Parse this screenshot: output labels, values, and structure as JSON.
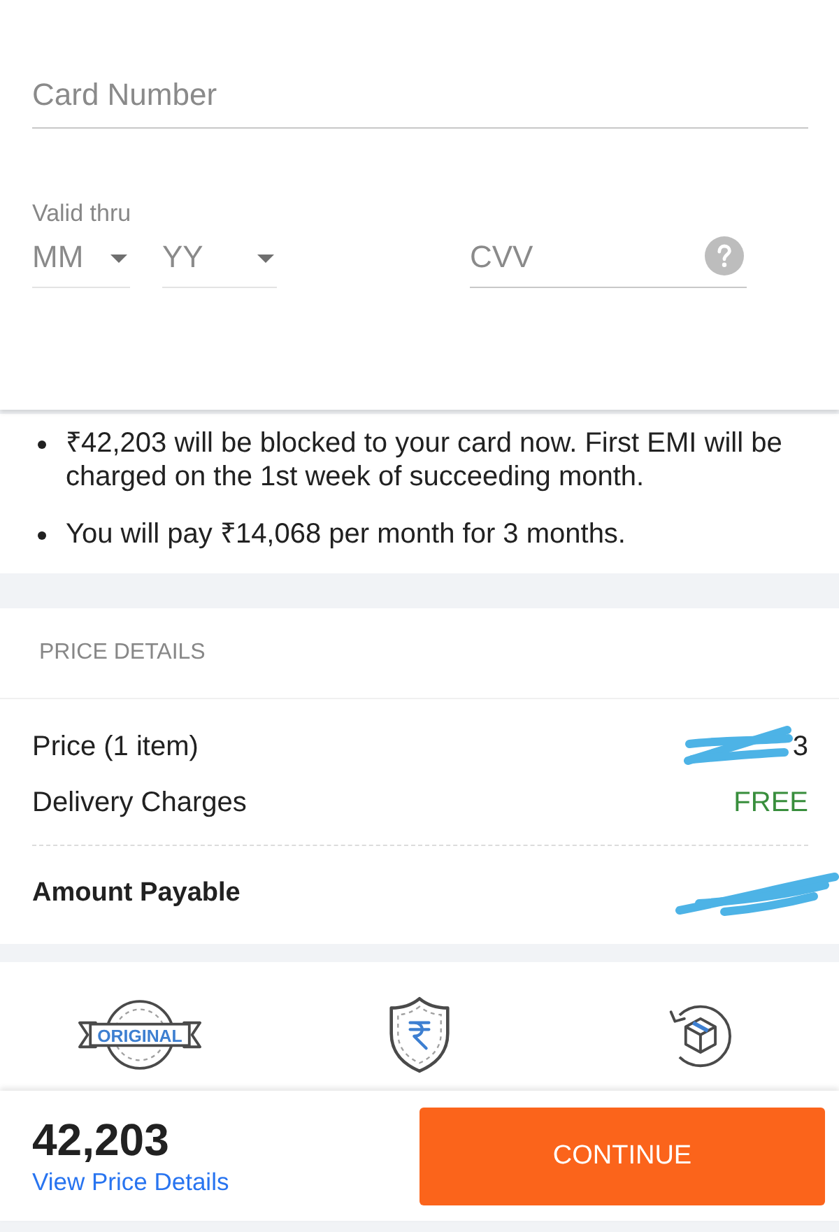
{
  "card_form": {
    "card_number": {
      "placeholder": "Card Number"
    },
    "valid_thru": {
      "label": "Valid thru",
      "month": {
        "placeholder": "MM"
      },
      "year": {
        "placeholder": "YY"
      }
    },
    "cvv": {
      "placeholder": "CVV"
    }
  },
  "emi_notes": [
    "₹42,203 will be blocked to your card now. First EMI will be charged on the 1st week of succeeding month.",
    "You will pay ₹14,068 per month for 3 months."
  ],
  "price_details": {
    "title": "PRICE DETAILS",
    "rows": [
      {
        "label": "Price (1 item)",
        "value": "3",
        "kind": "amount",
        "redacted": true
      },
      {
        "label": "Delivery Charges",
        "value": "FREE",
        "kind": "free",
        "redacted": false
      }
    ],
    "total": {
      "label": "Amount Payable",
      "redacted": true
    }
  },
  "badges": [
    {
      "kind": "original",
      "label": "ORIGINAL"
    },
    {
      "kind": "secure_payment"
    },
    {
      "kind": "easy_return"
    }
  ],
  "footer": {
    "amount": "42,203",
    "link": "View Price Details",
    "button": "CONTINUE"
  }
}
